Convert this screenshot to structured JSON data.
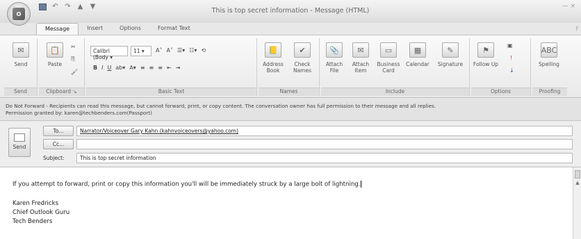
{
  "window": {
    "title": "This is top secret information - Message (HTML)",
    "office_button": "Office"
  },
  "tabs": [
    "Message",
    "Insert",
    "Options",
    "Format Text"
  ],
  "ribbon": {
    "send": {
      "button_label": "Send",
      "group_label": "Send"
    },
    "clipboard": {
      "paste_label": "Paste",
      "group_label": "Clipboard"
    },
    "basic_text": {
      "font": "Calibri (Body",
      "size": "11",
      "group_label": "Basic Text"
    },
    "names": {
      "address_book": "Address Book",
      "check_names": "Check Names",
      "group_label": "Names"
    },
    "include": {
      "attach_file": "Attach File",
      "attach_item": "Attach Item",
      "business_card": "Business Card",
      "calendar": "Calendar",
      "signature": "Signature",
      "group_label": "Include"
    },
    "options": {
      "follow_up": "Follow Up",
      "group_label": "Options"
    },
    "proofing": {
      "spelling": "Spelling",
      "group_label": "Proofing"
    }
  },
  "infobar": {
    "line1": "Do Not Forward - Recipients can read this message, but cannot forward, print, or copy content. The conversation owner has full permission to their message and all replies.",
    "line2": "Permission granted by: karen@techbenders.com(Passport)"
  },
  "header": {
    "send_label": "Send",
    "to_label": "To...",
    "to_value": "Narrator/Voiceover Gary Kahn (kahnvoiceovers@yahoo.com)",
    "cc_label": "Cc...",
    "cc_value": "",
    "subject_label": "Subject:",
    "subject_value": "This is top secret information"
  },
  "body": {
    "line1": "If you attempt to forward, print or copy this information you'll will be immediately struck by a large bolt of lightning.",
    "sig1": "Karen Fredricks",
    "sig2": "Chief Outlook Guru",
    "sig3": "Tech Benders"
  }
}
